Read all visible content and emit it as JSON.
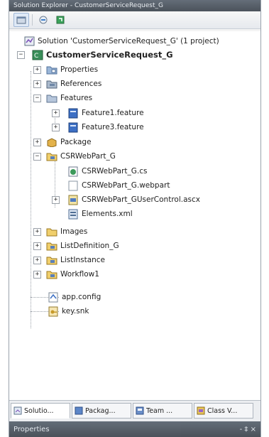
{
  "window": {
    "title": "Solution Explorer - CustomerServiceRequest_G"
  },
  "tree": {
    "solution": "Solution 'CustomerServiceRequest_G' (1 project)",
    "project": "CustomerServiceRequest_G",
    "properties": "Properties",
    "references": "References",
    "features": "Features",
    "feature1": "Feature1.feature",
    "feature3": "Feature3.feature",
    "package": "Package",
    "csrwebpart": "CSRWebPart_G",
    "csrwebpart_cs": "CSRWebPart_G.cs",
    "csrwebpart_webpart": "CSRWebPart_G.webpart",
    "csrwebpart_usercontrol": "CSRWebPart_GUserControl.ascx",
    "elements": "Elements.xml",
    "images": "Images",
    "listdefinition": "ListDefinition_G",
    "listinstance": "ListInstance",
    "workflow1": "Workflow1",
    "appconfig": "app.config",
    "keysnk": "key.snk"
  },
  "tabs": [
    "Solutio...",
    "Packag...",
    "Team ...",
    "Class V..."
  ],
  "properties_panel": {
    "title": "Properties",
    "pin": "- ‡ ×"
  }
}
